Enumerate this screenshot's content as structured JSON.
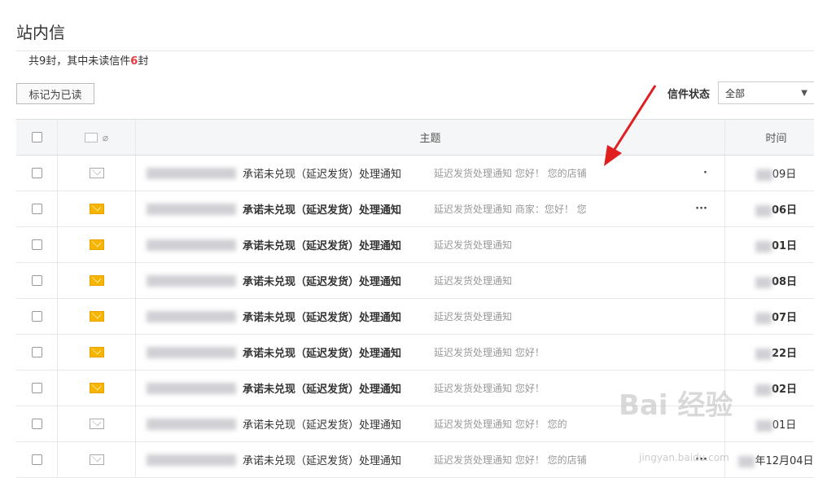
{
  "page": {
    "title": "站内信",
    "summary_prefix": "共9封，其中未读信件",
    "unread_count": "6",
    "summary_suffix": "封"
  },
  "toolbar": {
    "mark_read_label": "标记为已读",
    "filter_label": "信件状态",
    "filter_value": "全部"
  },
  "table": {
    "header_subject": "主题",
    "header_time": "时间",
    "rows": [
      {
        "state": "read",
        "subject": "承诺未兑现（延迟发货）处理通知",
        "preview": "延迟发货处理通知 您好！ 您的店铺",
        "more": "·",
        "time": "09日"
      },
      {
        "state": "unread",
        "subject": "承诺未兑现（延迟发货）处理通知",
        "preview": "延迟发货处理通知 商家：您好！ 您",
        "more": "···",
        "time": "06日"
      },
      {
        "state": "unread",
        "subject": "承诺未兑现（延迟发货）处理通知",
        "preview": "延迟发货处理通知",
        "more": "",
        "time": "01日"
      },
      {
        "state": "unread",
        "subject": "承诺未兑现（延迟发货）处理通知",
        "preview": "延迟发货处理通知",
        "more": "",
        "time": "08日"
      },
      {
        "state": "unread",
        "subject": "承诺未兑现（延迟发货）处理通知",
        "preview": "延迟发货处理通知",
        "more": "",
        "time": "07日"
      },
      {
        "state": "unread",
        "subject": "承诺未兑现（延迟发货）处理通知",
        "preview": "延迟发货处理通知 您好！",
        "more": "",
        "time": "22日"
      },
      {
        "state": "unread",
        "subject": "承诺未兑现（延迟发货）处理通知",
        "preview": "延迟发货处理通知 您好！",
        "more": "",
        "time": "02日"
      },
      {
        "state": "read",
        "subject": "承诺未兑现（延迟发货）处理通知",
        "preview": "延迟发货处理通知 您好！ 您的",
        "more": "",
        "time": "01日"
      },
      {
        "state": "read",
        "subject": "承诺未兑现（延迟发货）处理通知",
        "preview": "延迟发货处理通知 您好！ 您的店铺",
        "more": "···",
        "time": "年12月04日"
      }
    ]
  },
  "watermark": {
    "brand": "Bai 经验",
    "url": "jingyan.baidu.com"
  },
  "colors": {
    "unread_accent": "#e4393c",
    "envelope_unread": "#f7b500",
    "arrow": "#e02020"
  }
}
